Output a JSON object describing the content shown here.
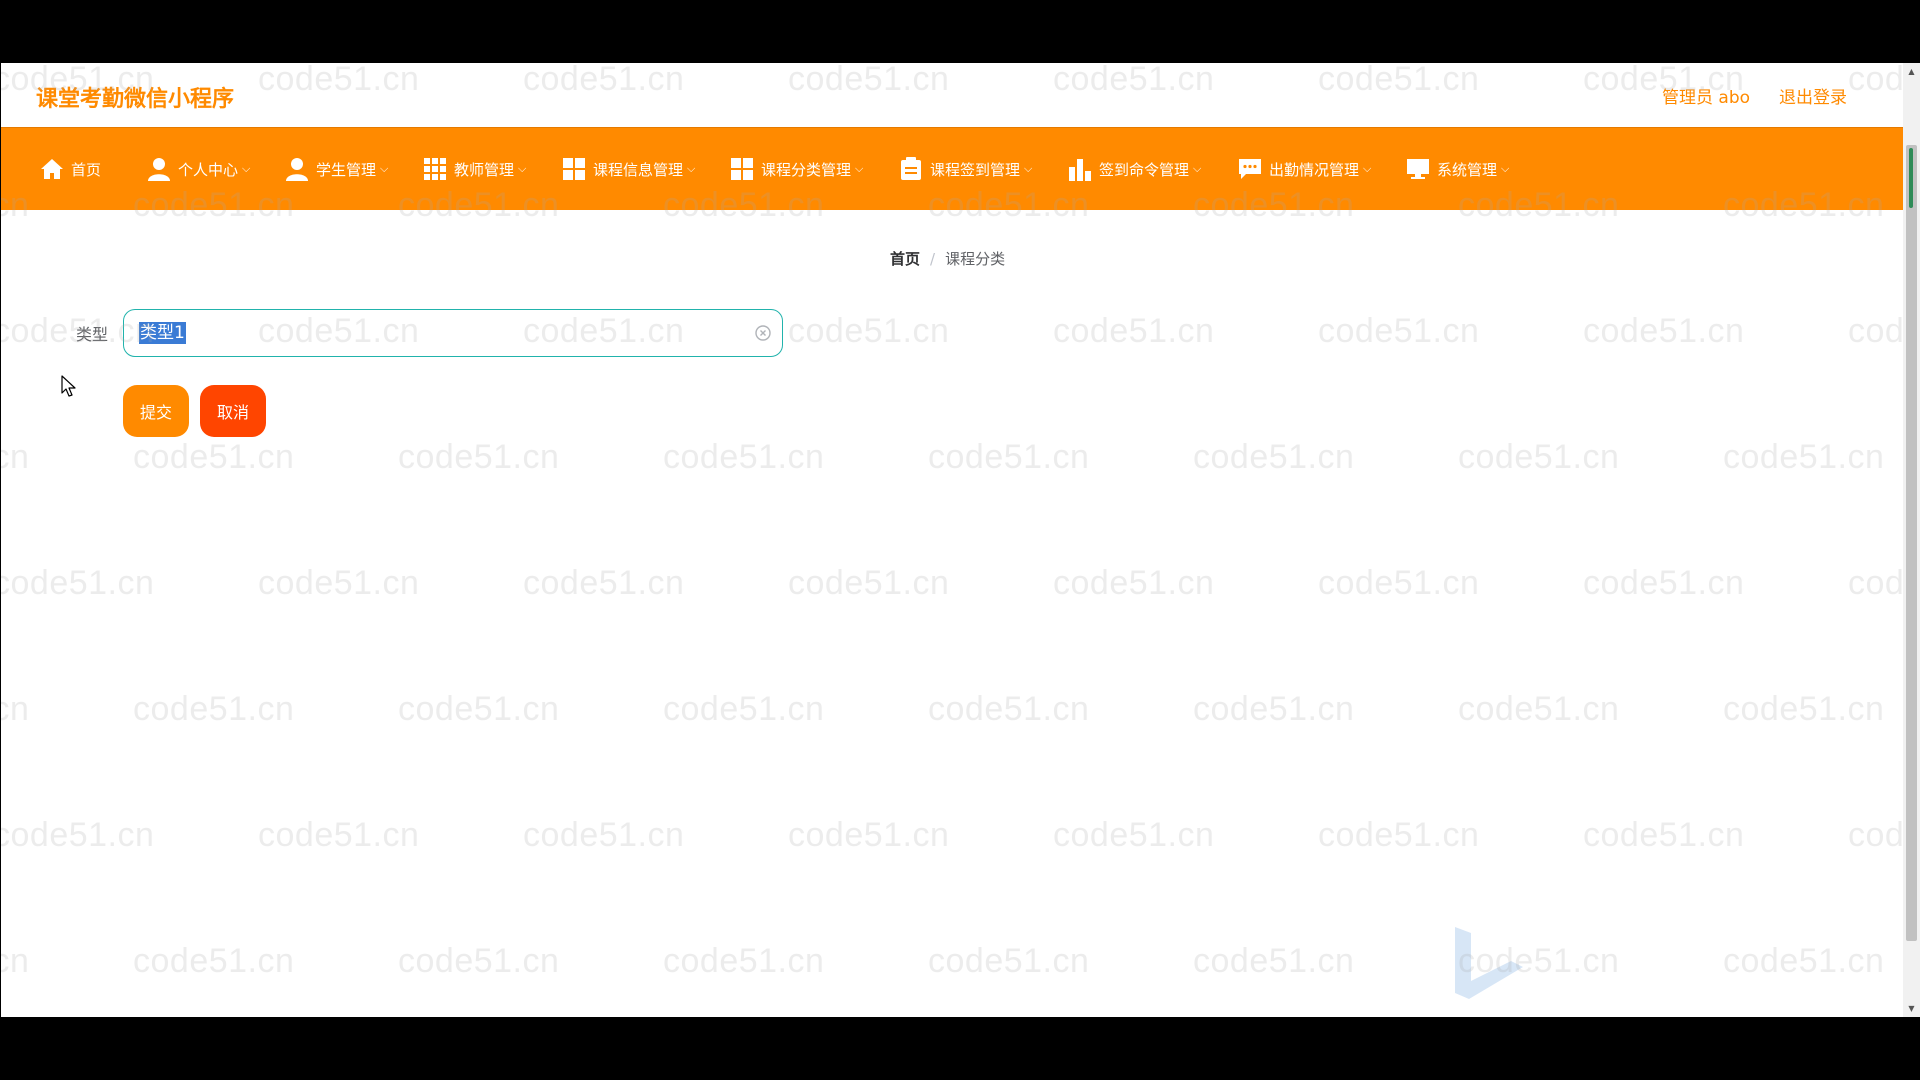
{
  "app": {
    "title": "课堂考勤微信小程序",
    "user_label": "管理员 abo",
    "logout_label": "退出登录"
  },
  "nav": {
    "items": [
      {
        "label": "首页",
        "icon": "home-icon"
      },
      {
        "label": "个人中心",
        "icon": "user-icon"
      },
      {
        "label": "学生管理",
        "icon": "user-icon"
      },
      {
        "label": "教师管理",
        "icon": "grid-icon"
      },
      {
        "label": "课程信息管理",
        "icon": "apps-icon"
      },
      {
        "label": "课程分类管理",
        "icon": "apps-icon"
      },
      {
        "label": "课程签到管理",
        "icon": "clipboard-icon"
      },
      {
        "label": "签到命令管理",
        "icon": "bar-chart-icon"
      },
      {
        "label": "出勤情况管理",
        "icon": "message-icon"
      },
      {
        "label": "系统管理",
        "icon": "monitor-icon"
      }
    ]
  },
  "breadcrumb": {
    "home": "首页",
    "separator": "/",
    "current": "课程分类"
  },
  "form": {
    "type_label": "类型",
    "type_value": "类型1",
    "submit_label": "提交",
    "cancel_label": "取消"
  },
  "watermark": {
    "text": "code51.cn"
  },
  "colors": {
    "accent": "#ff8a00",
    "danger": "#ff4500",
    "input_border": "#21b3ac",
    "selection": "#3a7bd5"
  }
}
